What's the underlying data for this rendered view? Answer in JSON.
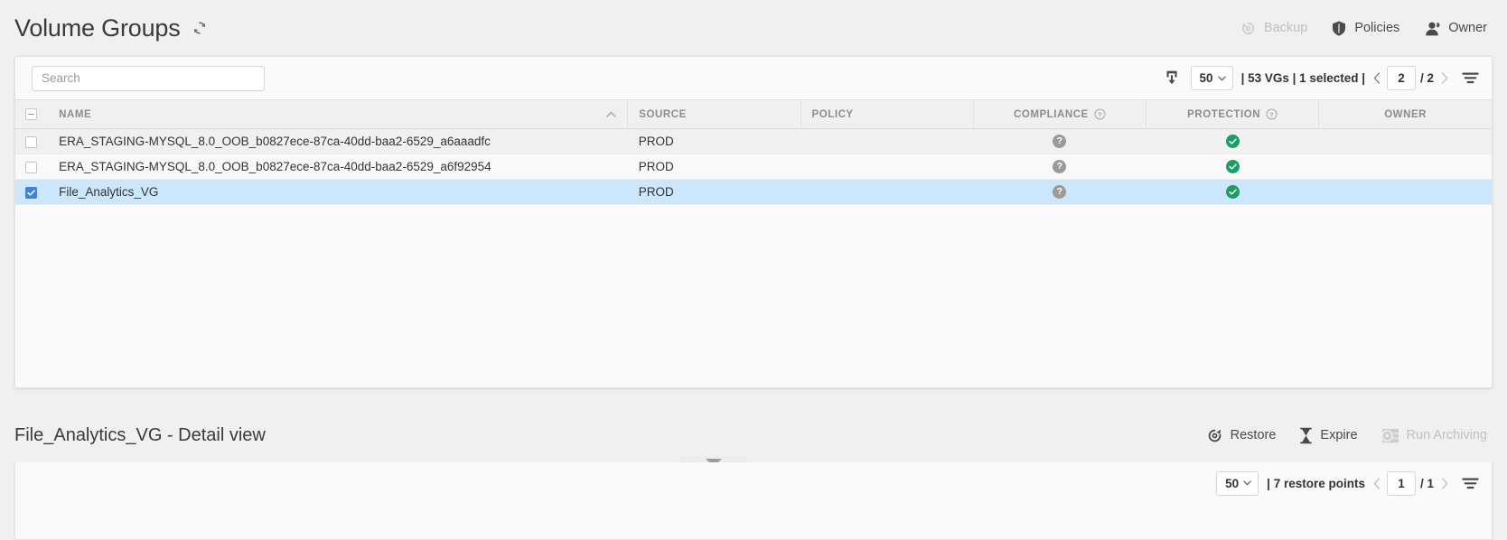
{
  "header": {
    "title": "Volume Groups",
    "refresh_icon": "refresh-icon",
    "actions": [
      {
        "label": "Backup",
        "icon": "backup-restore-icon",
        "disabled": true
      },
      {
        "label": "Policies",
        "icon": "shield-icon",
        "disabled": false
      },
      {
        "label": "Owner",
        "icon": "user-icon",
        "disabled": false
      }
    ]
  },
  "toolbar": {
    "search_placeholder": "Search",
    "search_value": "",
    "export_icon": "export-download-icon",
    "page_size": "50",
    "count_text": "| 53 VGs | 1 selected |",
    "prev_icon": "chevron-left-icon",
    "next_icon": "chevron-right-icon",
    "page_number": "2",
    "page_total": "/ 2",
    "filter_icon": "filter-icon"
  },
  "table": {
    "select_all_state": "indeterminate",
    "sort_column": "NAME",
    "sort_direction": "asc",
    "columns": [
      {
        "label": "NAME",
        "align": "left",
        "help": false
      },
      {
        "label": "SOURCE",
        "align": "left",
        "help": false
      },
      {
        "label": "POLICY",
        "align": "left",
        "help": false
      },
      {
        "label": "COMPLIANCE",
        "align": "center",
        "help": true
      },
      {
        "label": "PROTECTION",
        "align": "center",
        "help": true
      },
      {
        "label": "OWNER",
        "align": "center",
        "help": false
      }
    ],
    "rows": [
      {
        "selected": false,
        "name": "ERA_STAGING-MYSQL_8.0_OOB_b0827ece-87ca-40dd-baa2-6529_a6aaadfc",
        "source": "PROD",
        "policy": "",
        "compliance": "?",
        "protection": "ok",
        "owner": ""
      },
      {
        "selected": false,
        "name": "ERA_STAGING-MYSQL_8.0_OOB_b0827ece-87ca-40dd-baa2-6529_a6f92954",
        "source": "PROD",
        "policy": "",
        "compliance": "?",
        "protection": "ok",
        "owner": ""
      },
      {
        "selected": true,
        "name": "File_Analytics_VG",
        "source": "PROD",
        "policy": "",
        "compliance": "?",
        "protection": "ok",
        "owner": ""
      }
    ]
  },
  "detail": {
    "title": "File_Analytics_VG - Detail view",
    "collapse_icon": "triangle-down-icon",
    "actions": [
      {
        "label": "Restore",
        "icon": "restore-icon",
        "disabled": false
      },
      {
        "label": "Expire",
        "icon": "hourglass-icon",
        "disabled": false
      },
      {
        "label": "Run Archiving",
        "icon": "archive-run-icon",
        "disabled": true
      }
    ],
    "toolbar": {
      "page_size": "50",
      "count_text": "| 7 restore points",
      "page_number": "1",
      "page_total": "/ 1",
      "filter_icon": "filter-icon",
      "prev_icon": "chevron-left-icon",
      "next_icon": "chevron-right-icon"
    }
  },
  "colors": {
    "accent_blue": "#3d82d6",
    "row_selected": "#cce7fb",
    "status_ok_green": "#1a9e62",
    "status_unknown_gray": "#9a9a9a"
  }
}
